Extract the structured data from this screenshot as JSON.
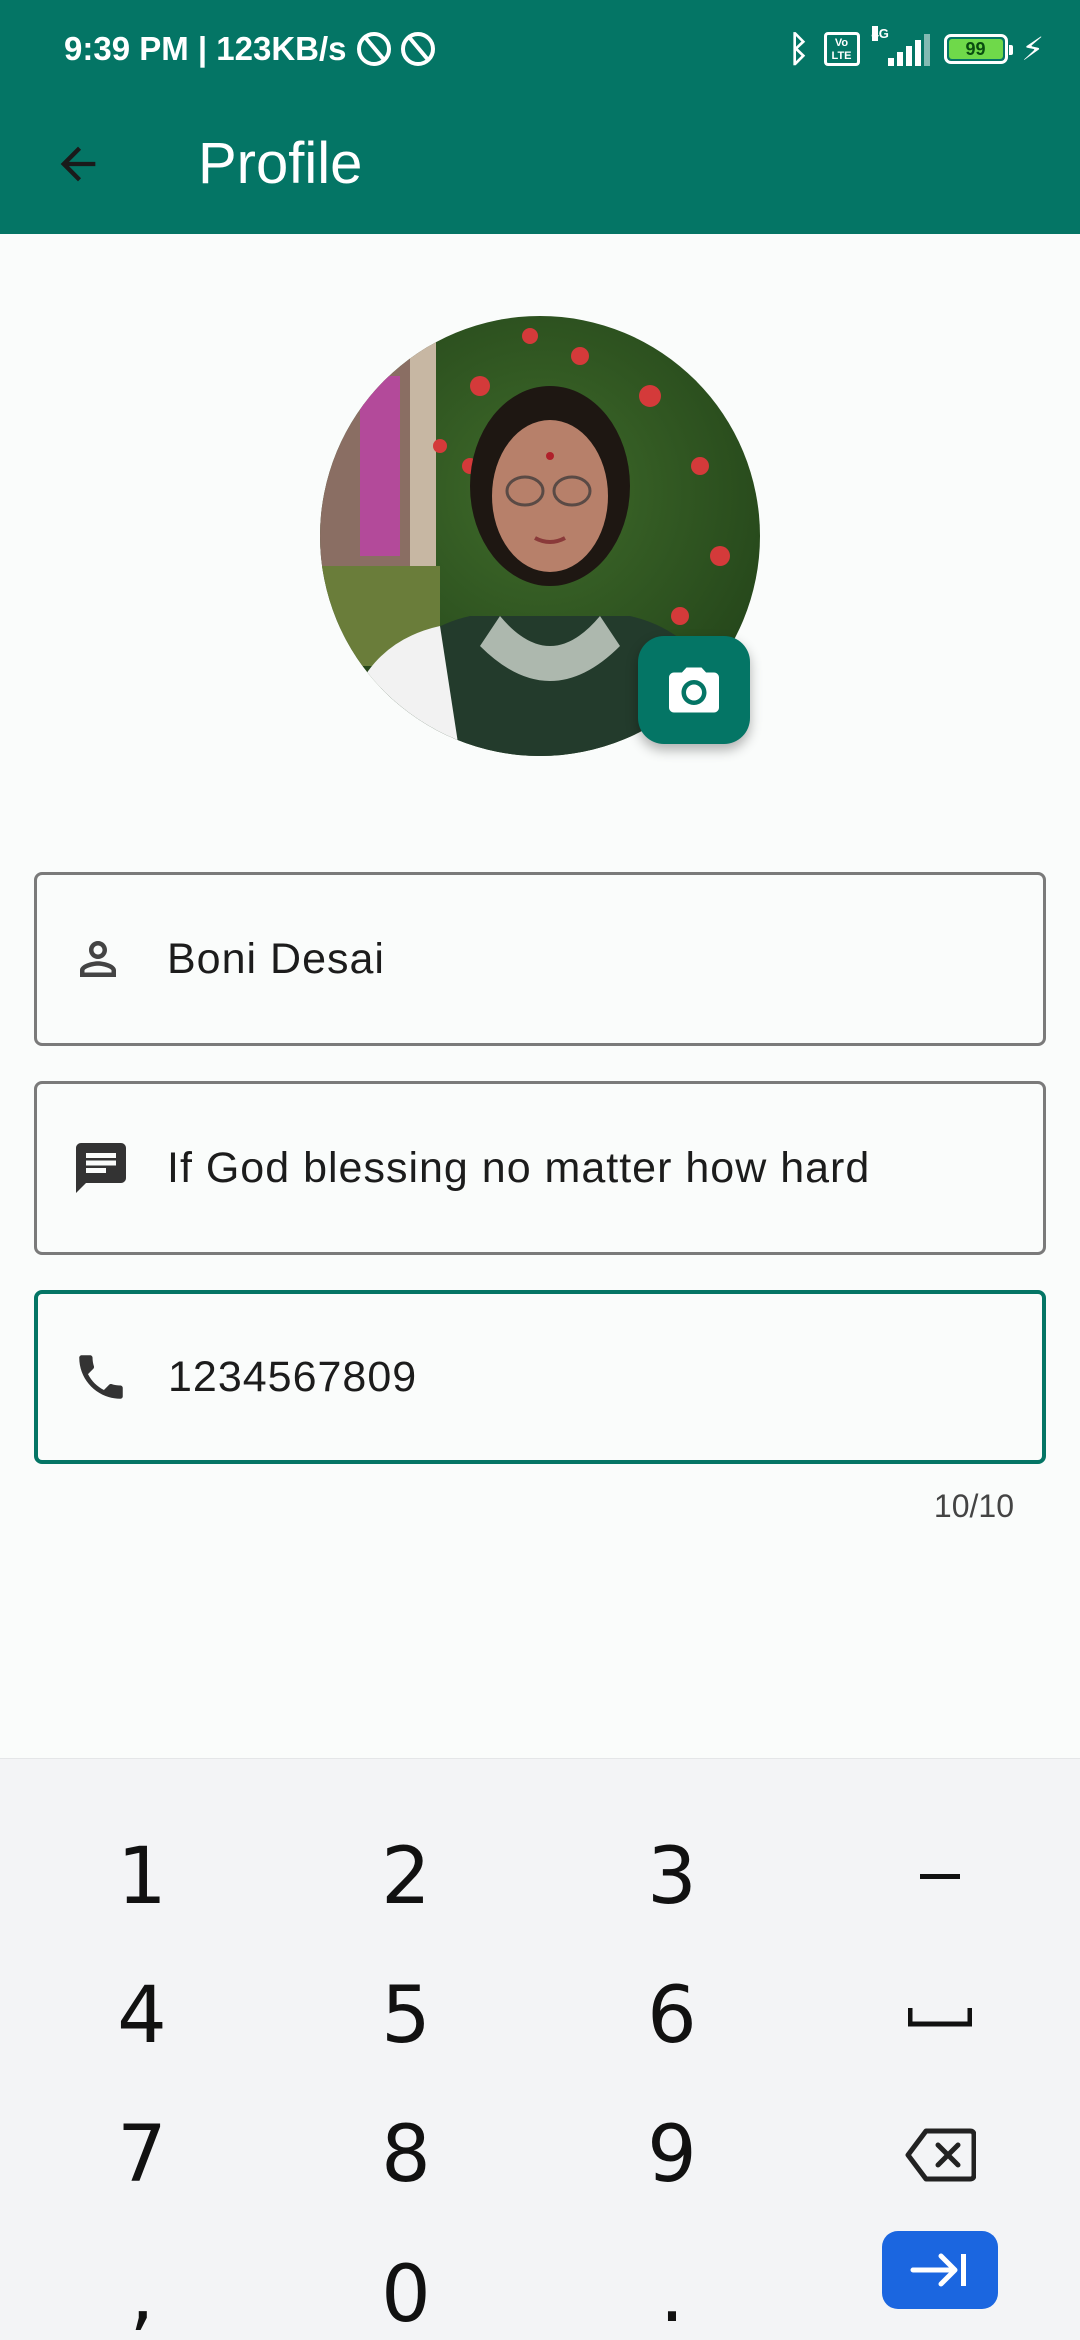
{
  "status_bar": {
    "time_speed": "9:39 PM | 123KB/s",
    "network_type": "4G",
    "volte": "Vo LTE",
    "battery": "99"
  },
  "app_bar": {
    "title": "Profile"
  },
  "colors": {
    "primary": "#047565",
    "keyboard_bg": "#f3f4f6",
    "enter_key": "#1b66e0"
  },
  "profile": {
    "name": "Boni Desai",
    "about": "If God blessing no matter how hard",
    "phone": "1234567809",
    "phone_counter": "10/10"
  },
  "keyboard": {
    "rows": [
      [
        "1",
        "2",
        "3",
        "-"
      ],
      [
        "4",
        "5",
        "6",
        "space"
      ],
      [
        "7",
        "8",
        "9",
        "backspace"
      ],
      [
        ",",
        "0",
        ".",
        "enter"
      ]
    ]
  }
}
